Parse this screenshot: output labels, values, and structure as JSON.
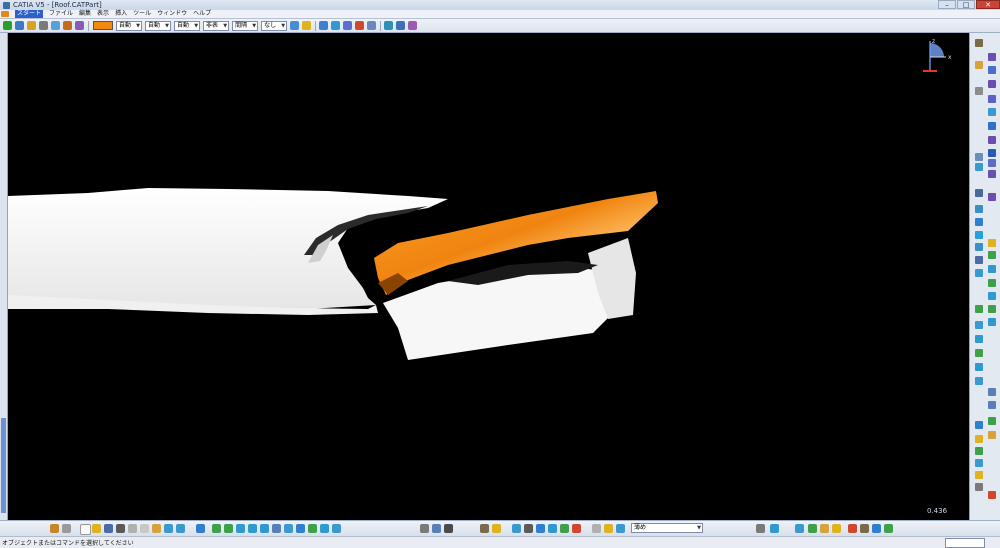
{
  "window": {
    "title": "CATIA V5 - [Roof.CATPart]",
    "buttons": [
      "–",
      "□",
      "✕"
    ]
  },
  "menubar": {
    "items": [
      "スタート",
      "ファイル",
      "編集",
      "表示",
      "挿入",
      "ツール",
      "ウィンドウ",
      "ヘルプ"
    ]
  },
  "toolbar": {
    "color_value": "#f28a10",
    "combos": [
      {
        "name": "linetype-combo",
        "value": "自動"
      },
      {
        "name": "thickness-combo",
        "value": "自動"
      },
      {
        "name": "layer-combo",
        "value": "自動"
      },
      {
        "name": "render-style-combo",
        "value": "非表"
      },
      {
        "name": "filter-combo",
        "value": "間隔"
      },
      {
        "name": "transparency-combo",
        "value": "なし"
      }
    ]
  },
  "viewport": {
    "background": "#000000",
    "compass": {
      "z_label": "z",
      "x_label": "x"
    },
    "model_colors": {
      "wing": "#f5f5f5",
      "spoiler": "#f28a10"
    },
    "zoom_readout": "0.436"
  },
  "bottom_toolbar": {
    "combo_value": "薄め"
  },
  "status": {
    "text": "オブジェクトまたはコマンドを選択してください"
  }
}
